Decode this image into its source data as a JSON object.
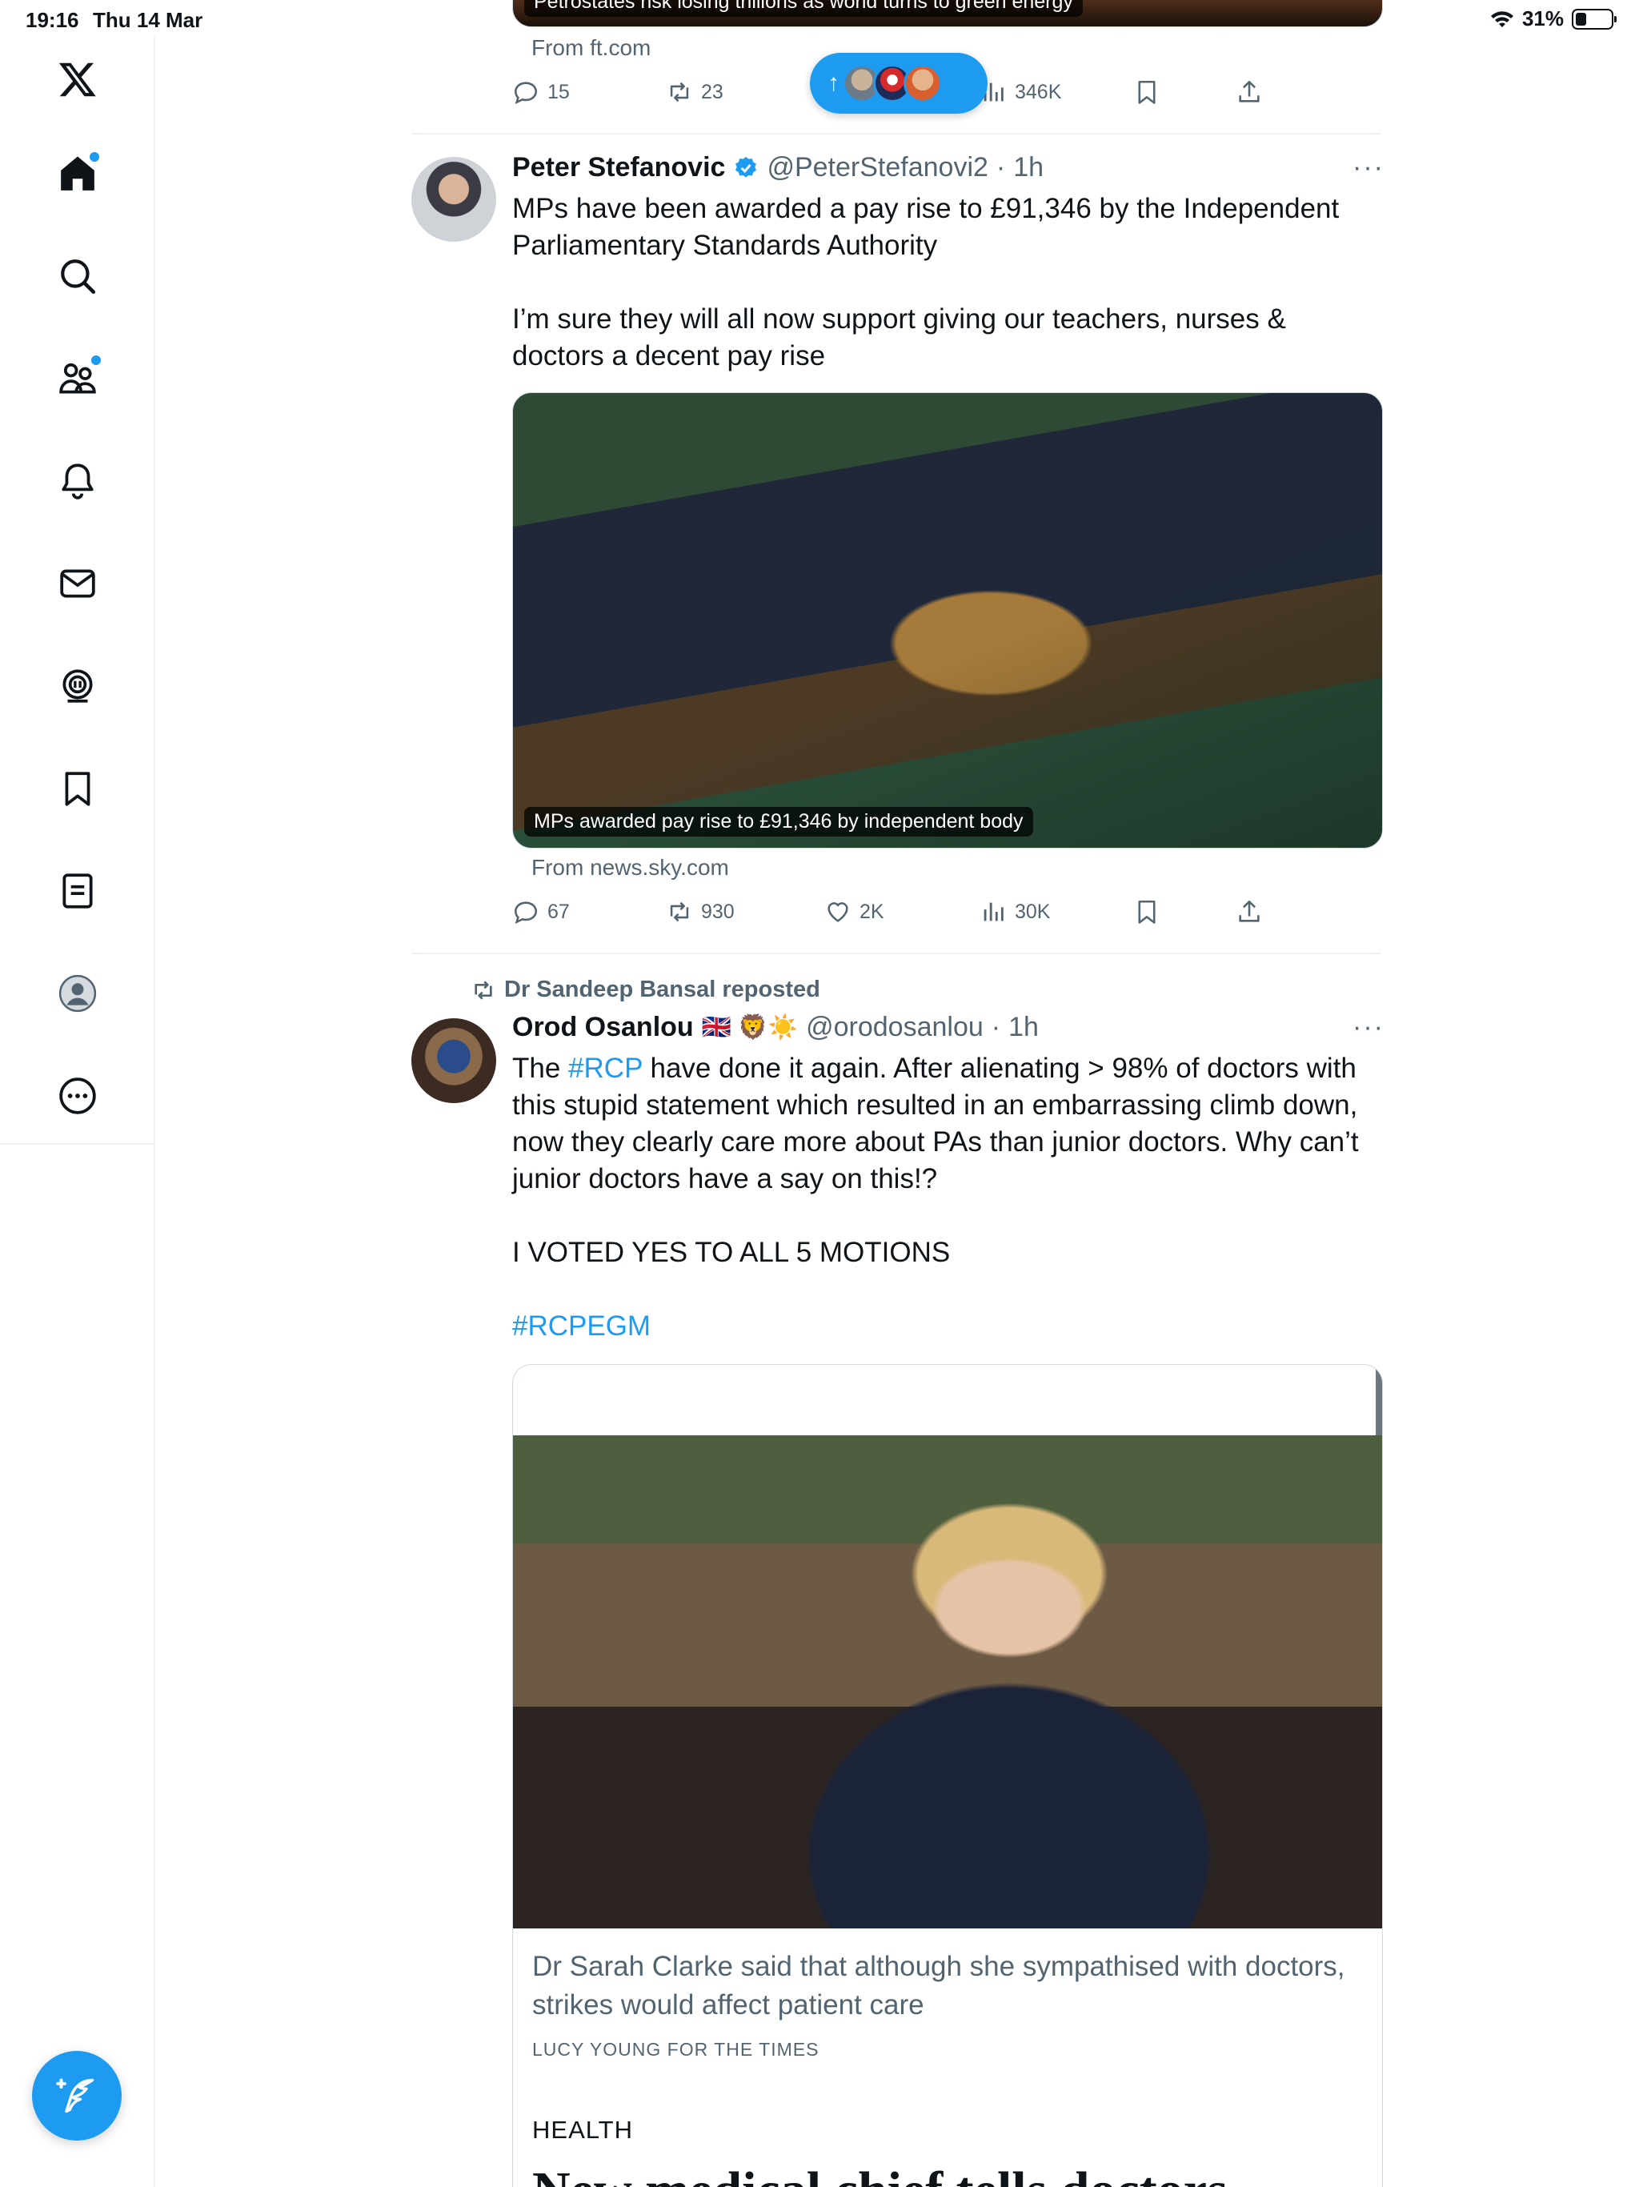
{
  "status_bar": {
    "time": "19:16",
    "date": "Thu 14 Mar",
    "battery": "31%",
    "battery_level": 0.31
  },
  "sidebar": {
    "items": [
      {
        "name": "x-logo-icon"
      },
      {
        "name": "home-icon",
        "badge": true
      },
      {
        "name": "search-icon"
      },
      {
        "name": "communities-icon",
        "badge": true
      },
      {
        "name": "notifications-icon"
      },
      {
        "name": "messages-icon"
      },
      {
        "name": "grok-icon"
      },
      {
        "name": "bookmarks-icon"
      },
      {
        "name": "lists-icon"
      },
      {
        "name": "profile-icon"
      },
      {
        "name": "more-icon"
      }
    ],
    "compose_icon": "compose-feather-icon"
  },
  "prev_tweet": {
    "media_caption": "Petrostates risk losing trillions as world turns to green energy",
    "source": "From ft.com",
    "replies": "15",
    "reposts": "23",
    "views": "346K"
  },
  "new_posts_pill": {
    "icon": "arrow-up-icon"
  },
  "tweet1": {
    "name": "Peter Stefanovic",
    "verified": true,
    "handle": "@PeterStefanovi2",
    "dot": "·",
    "time": "1h",
    "more": "···",
    "text_lines": [
      "MPs have been awarded a pay rise to £91,346 by the Independent Parliamentary Standards Authority",
      "",
      "I’m sure they will all now support giving our teachers, nurses & doctors a decent pay rise"
    ],
    "media_caption": "MPs awarded pay rise to £91,346 by independent body",
    "source": "From news.sky.com",
    "replies": "67",
    "reposts": "930",
    "likes": "2K",
    "views": "30K"
  },
  "tweet2": {
    "repost_label": "Dr Sandeep Bansal reposted",
    "name": "Orod Osanlou",
    "emojis": "🇬🇧 🦁☀️",
    "handle": "@orodosanlou",
    "dot": "·",
    "time": "1h",
    "more": "···",
    "text_pre": "The ",
    "hashtag1": "#RCP",
    "text_post": " have done it again. After alienating > 98% of doctors with this stupid statement which resulted in an embarrassing climb down, now they clearly care more about PAs than junior doctors. Why can’t junior doctors have a say on this!?",
    "text_line2": "I VOTED YES TO ALL 5 MOTIONS",
    "hashtag2": "#RCPEGM",
    "card": {
      "caption": "Dr Sarah Clarke said that although she sympathised with doctors, strikes would affect patient care",
      "credit": "LUCY YOUNG FOR THE TIMES",
      "section": "HEALTH",
      "headline": "New medical chief tells doctors"
    }
  }
}
